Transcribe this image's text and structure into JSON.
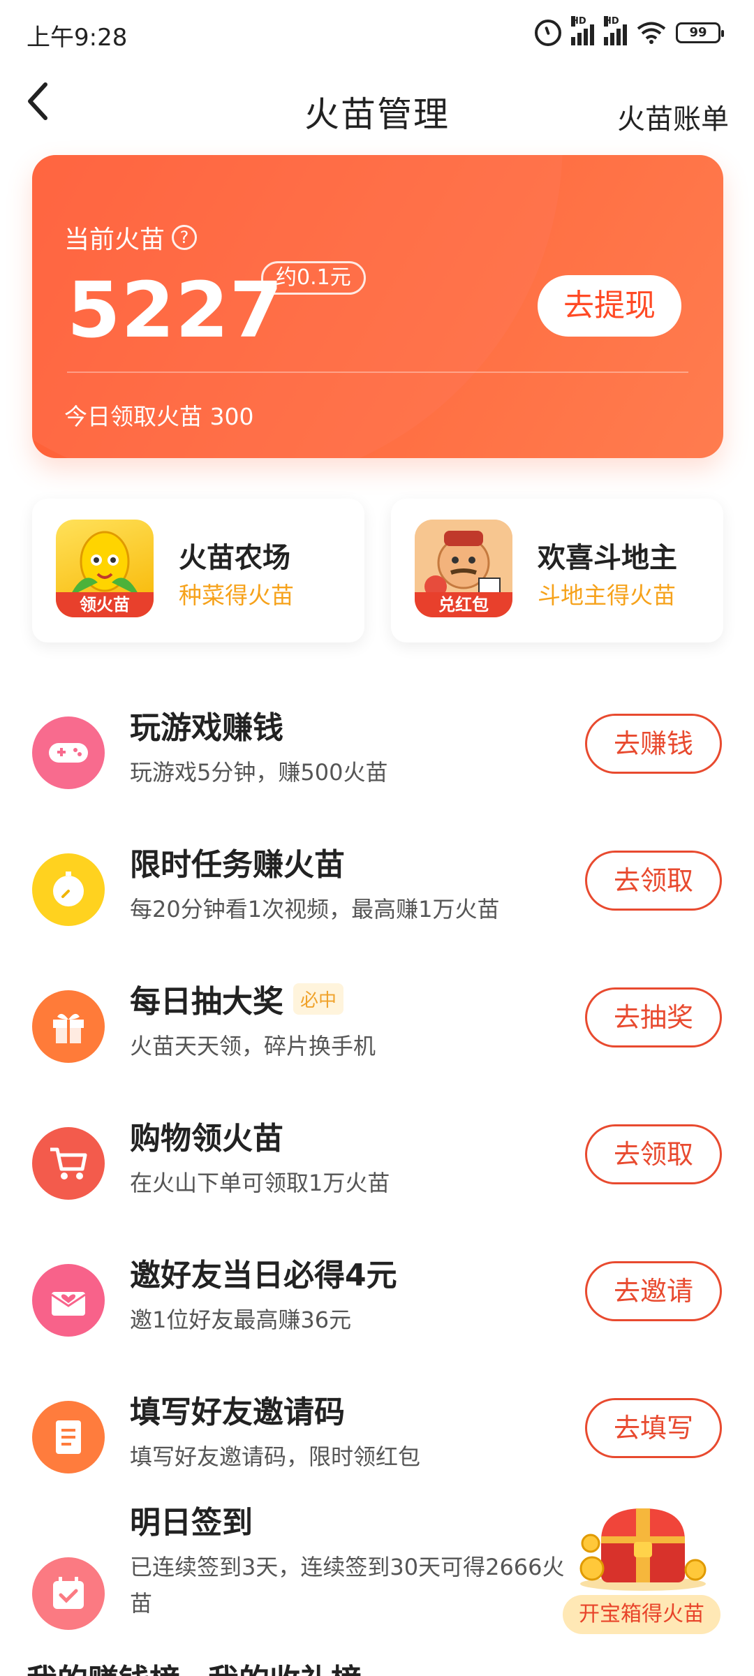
{
  "status_bar": {
    "time": "上午9:28",
    "battery": "99"
  },
  "header": {
    "title": "火苗管理",
    "bill_link": "火苗账单"
  },
  "balance_card": {
    "label": "当前火苗",
    "help": "?",
    "amount": "5227",
    "approx": "约0.1元",
    "withdraw_button": "去提现",
    "today": "今日领取火苗 300"
  },
  "promos": [
    {
      "name": "火苗农场",
      "sub": "种菜得火苗",
      "tag": "领火苗"
    },
    {
      "name": "欢喜斗地主",
      "sub": "斗地主得火苗",
      "tag": "兑红包"
    }
  ],
  "tasks": [
    {
      "title": "玩游戏赚钱",
      "desc": "玩游戏5分钟，赚500火苗",
      "button": "去赚钱"
    },
    {
      "title": "限时任务赚火苗",
      "desc": "每20分钟看1次视频，最高赚1万火苗",
      "button": "去领取"
    },
    {
      "title": "每日抽大奖",
      "badge": "必中",
      "desc": "火苗天天领，碎片换手机",
      "button": "去抽奖"
    },
    {
      "title": "购物领火苗",
      "desc": "在火山下单可领取1万火苗",
      "button": "去领取"
    },
    {
      "title": "邀好友当日必得4元",
      "desc": "邀1位好友最高赚36元",
      "button": "去邀请"
    },
    {
      "title": "填写好友邀请码",
      "desc": "填写好友邀请码，限时领红包",
      "button": "去填写"
    },
    {
      "title": "明日签到",
      "desc": "已连续签到3天，连续签到30天可得2666火苗"
    }
  ],
  "treasure": {
    "label": "开宝箱得火苗"
  },
  "bottom": {
    "tab1": "我的赚钱榜",
    "tab2": "我的收礼榜"
  }
}
